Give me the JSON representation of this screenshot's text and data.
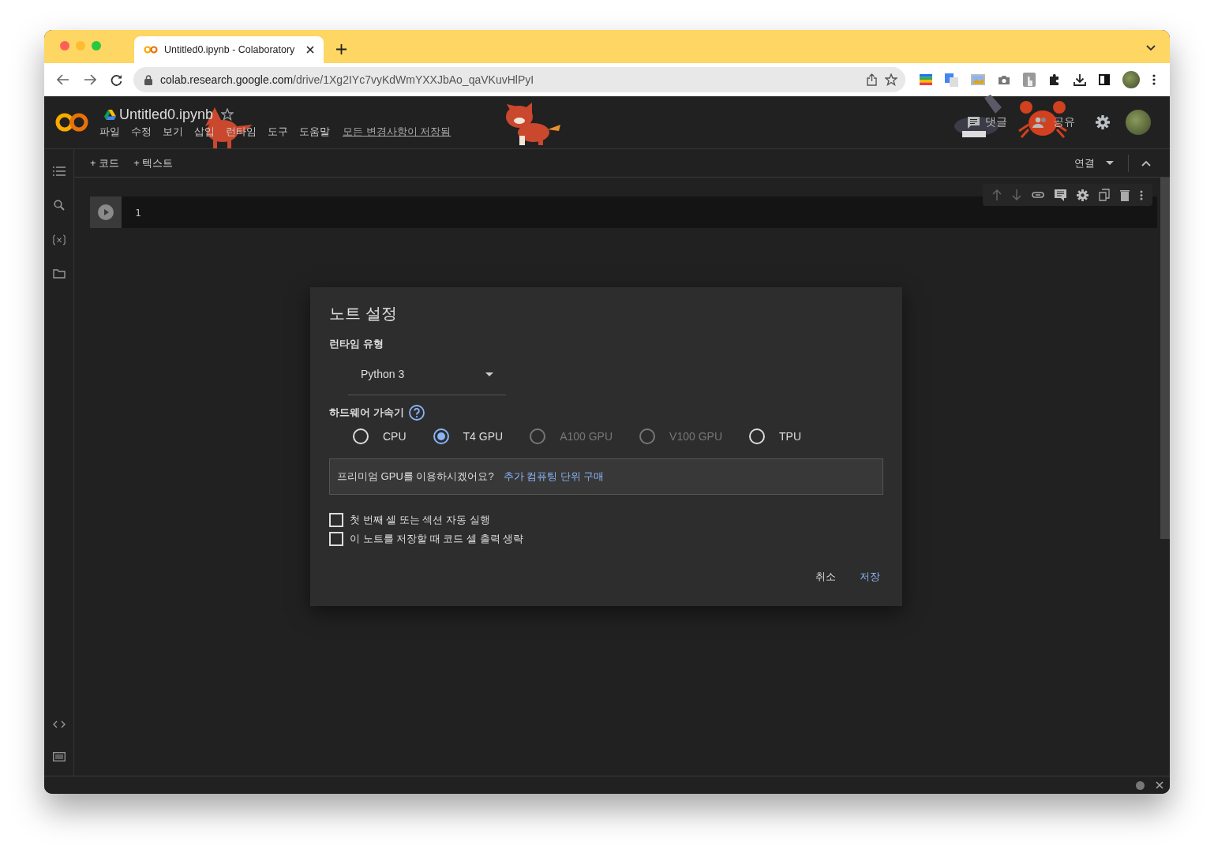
{
  "browser": {
    "tab_title": "Untitled0.ipynb - Colaboratory",
    "url_host": "colab.research.google.com",
    "url_path": "/drive/1Xg2IYc7vyKdWmYXXJbAo_qaVKuvHlPyI"
  },
  "notebook": {
    "title": "Untitled0.ipynb",
    "menu": [
      "파일",
      "수정",
      "보기",
      "삽입",
      "런타임",
      "도구",
      "도움말"
    ],
    "save_status": "모든 변경사항이 저장됨",
    "comment_label": "댓글",
    "share_label": "공유"
  },
  "toolbar": {
    "add_code": "+ 코드",
    "add_text": "+ 텍스트",
    "connect": "연결"
  },
  "cell": {
    "line_number": "1"
  },
  "dialog": {
    "title": "노트 설정",
    "runtime_label": "런타임 유형",
    "runtime_value": "Python 3",
    "accelerator_label": "하드웨어 가속기",
    "accelerators": [
      {
        "label": "CPU",
        "selected": false,
        "disabled": false
      },
      {
        "label": "T4 GPU",
        "selected": true,
        "disabled": false
      },
      {
        "label": "A100 GPU",
        "selected": false,
        "disabled": true
      },
      {
        "label": "V100 GPU",
        "selected": false,
        "disabled": true
      },
      {
        "label": "TPU",
        "selected": false,
        "disabled": false
      }
    ],
    "premium_text": "프리미엄 GPU를 이용하시겠어요?",
    "premium_link": "추가 컴퓨팅 단위 구매",
    "options": [
      {
        "label": "첫 번째 셀 또는 섹션 자동 실행",
        "checked": false
      },
      {
        "label": "이 노트를 저장할 때 코드 셀 출력 생략",
        "checked": false
      }
    ],
    "buttons": [
      {
        "label": "취소",
        "kind": "cancel"
      },
      {
        "label": "저장",
        "kind": "save"
      }
    ]
  }
}
